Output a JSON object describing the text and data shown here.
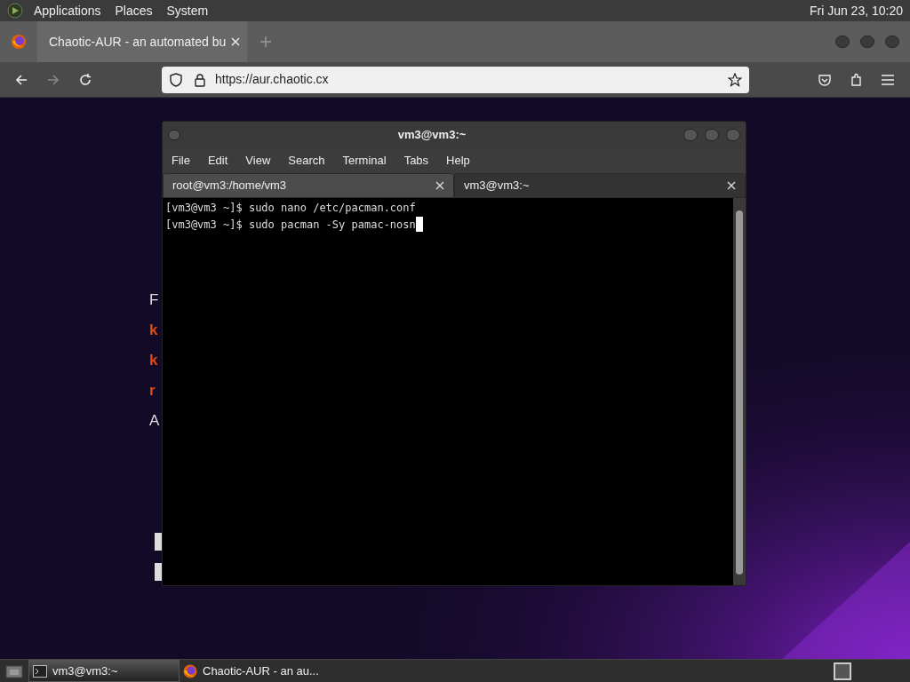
{
  "top_panel": {
    "menus": [
      "Applications",
      "Places",
      "System"
    ],
    "clock": "Fri Jun 23, 10:20"
  },
  "browser": {
    "tabs": [
      {
        "title": "Chaotic-AUR - an automated bu",
        "selected": true
      }
    ],
    "url": "https://aur.chaotic.cx",
    "page_fragments": [
      {
        "text": "F",
        "kind": "plain"
      },
      {
        "text": "k",
        "kind": "accent"
      },
      {
        "text": "k",
        "kind": "accent"
      },
      {
        "text": "r",
        "kind": "accent"
      },
      {
        "text": "A",
        "kind": "plain"
      }
    ]
  },
  "terminal": {
    "title": "vm3@vm3:~",
    "menu": [
      "File",
      "Edit",
      "View",
      "Search",
      "Terminal",
      "Tabs",
      "Help"
    ],
    "tabs": [
      {
        "title": "root@vm3:/home/vm3",
        "selected": false
      },
      {
        "title": "vm3@vm3:~",
        "selected": true
      }
    ],
    "lines": [
      "[vm3@vm3 ~]$ sudo nano /etc/pacman.conf",
      "[vm3@vm3 ~]$ sudo pacman -Sy pamac-nosn"
    ]
  },
  "taskbar": {
    "items": [
      {
        "label": "vm3@vm3:~",
        "kind": "terminal",
        "selected": true
      },
      {
        "label": "Chaotic-AUR - an au...",
        "kind": "browser",
        "selected": false
      }
    ]
  }
}
